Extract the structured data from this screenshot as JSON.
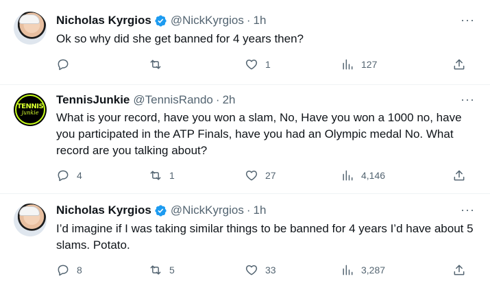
{
  "tweets": [
    {
      "name": "Nicholas Kyrgios",
      "handle": "@NickKyrgios",
      "time": "1h",
      "text": "Ok so why did she get banned for 4 years then?",
      "replies": "",
      "retweets": "",
      "likes": "1",
      "views": "127",
      "avatar": "nick-kyrgios-avatar"
    },
    {
      "name": "TennisJunkie",
      "handle": "@TennisRando",
      "time": "2h",
      "text": "What is your record, have you won a slam, No, Have you won a 1000 no, have you participated in the ATP Finals, have you had an Olympic medal No. What record are you talking about?",
      "replies": "4",
      "retweets": "1",
      "likes": "27",
      "views": "4,146",
      "avatar_text_1": "TENNIS",
      "avatar_text_2": "junkie"
    },
    {
      "name": "Nicholas Kyrgios",
      "handle": "@NickKyrgios",
      "time": "1h",
      "text": "I’d imagine if I was taking similar things to be banned for 4 years I’d have about 5 slams. Potato.",
      "replies": "8",
      "retweets": "5",
      "likes": "33",
      "views": "3,287",
      "avatar": "nick-kyrgios-avatar"
    }
  ],
  "separator": "·",
  "more_icon": "···",
  "colors": {
    "verified": "#1d9bf0",
    "secondary_text": "#536471",
    "primary_text": "#0f1419",
    "thread_line": "#cfd9de",
    "tennisjunkie_logo": "#d6ff2e"
  }
}
